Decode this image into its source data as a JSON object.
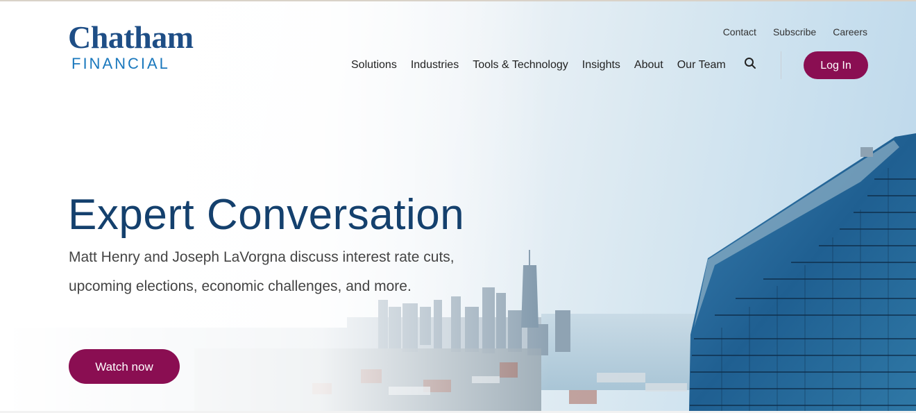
{
  "brand": {
    "name": "Chatham",
    "subtitle": "FINANCIAL",
    "primary_color": "#1e4e86",
    "secondary_color": "#1a78bd",
    "accent_color": "#8a0e52"
  },
  "utility_nav": [
    "Contact",
    "Subscribe",
    "Careers"
  ],
  "main_nav": [
    "Solutions",
    "Industries",
    "Tools & Technology",
    "Insights",
    "About",
    "Our Team"
  ],
  "search": {
    "icon": "search-icon"
  },
  "login_label": "Log In",
  "hero": {
    "title": "Expert Conversation",
    "description": "Matt Henry and Joseph LaVorgna discuss interest rate cuts, upcoming elections, economic challenges, and more.",
    "cta_label": "Watch now",
    "background": "city-skyline-with-glass-skyscraper"
  }
}
